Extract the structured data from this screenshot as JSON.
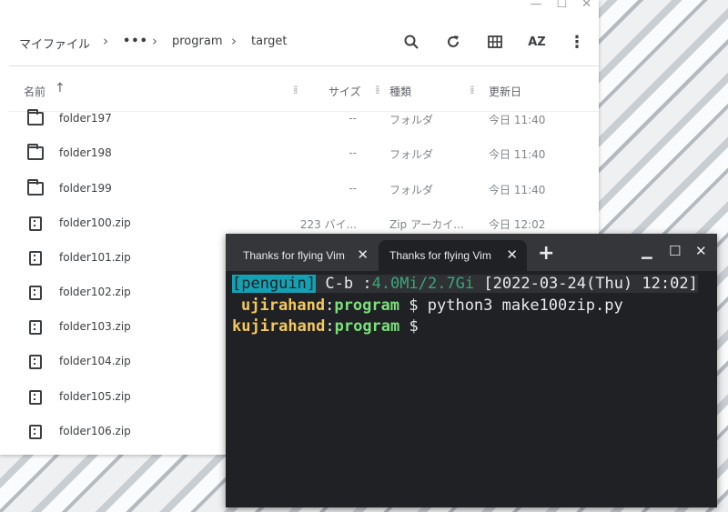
{
  "files_window": {
    "breadcrumb": [
      "マイファイル",
      "•••",
      "program",
      "target"
    ],
    "columns": {
      "name": "名前",
      "size": "サイズ",
      "type": "種類",
      "modified": "更新日"
    },
    "rows": [
      {
        "name": "folder197",
        "size": "--",
        "type": "フォルダ",
        "modified": "今日 11:40",
        "kind": "folder"
      },
      {
        "name": "folder198",
        "size": "--",
        "type": "フォルダ",
        "modified": "今日 11:40",
        "kind": "folder"
      },
      {
        "name": "folder199",
        "size": "--",
        "type": "フォルダ",
        "modified": "今日 11:40",
        "kind": "folder"
      },
      {
        "name": "folder100.zip",
        "size": "223 バイ...",
        "type": "Zip アーカイ...",
        "modified": "今日 12:02",
        "kind": "zip"
      },
      {
        "name": "folder101.zip",
        "size": "",
        "type": "",
        "modified": "",
        "kind": "zip"
      },
      {
        "name": "folder102.zip",
        "size": "",
        "type": "",
        "modified": "",
        "kind": "zip"
      },
      {
        "name": "folder103.zip",
        "size": "",
        "type": "",
        "modified": "",
        "kind": "zip"
      },
      {
        "name": "folder104.zip",
        "size": "",
        "type": "",
        "modified": "",
        "kind": "zip"
      },
      {
        "name": "folder105.zip",
        "size": "",
        "type": "",
        "modified": "",
        "kind": "zip"
      },
      {
        "name": "folder106.zip",
        "size": "",
        "type": "",
        "modified": "",
        "kind": "zip"
      }
    ],
    "icons": {
      "search": "search-icon",
      "refresh": "refresh-icon",
      "grid": "grid-view-icon",
      "sort": "sort-az-icon",
      "more": "more-vert-icon"
    }
  },
  "terminal": {
    "tabs": [
      "Thanks for flying Vim",
      "Thanks for flying Vim"
    ],
    "status": {
      "session": "[penguin]",
      "prefix": "C-b :",
      "mem": "4.0Mi/2.7Gi",
      "datetime": "[2022-03-24(Thu) 12:02]"
    },
    "lines": [
      {
        "user": "ujirahand",
        "dir": "program",
        "cmd": "$ python3 make100zip.py"
      },
      {
        "user": "kujirahand",
        "dir": "program",
        "cmd": "$"
      }
    ],
    "colors": {
      "penguin_bg": "#14a1b4",
      "mem": "#3aa57b",
      "user": "#f4c95d",
      "dir": "#7be07b"
    }
  }
}
